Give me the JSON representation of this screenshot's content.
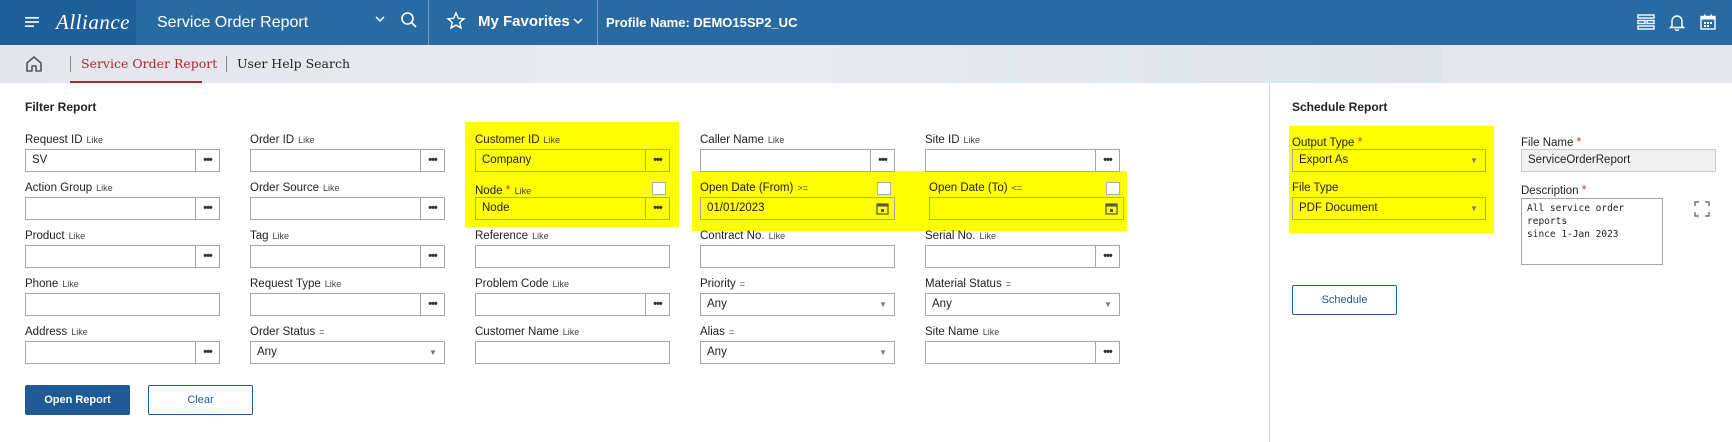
{
  "topbar": {
    "brand": "Alliance",
    "app_title": "Service Order Report",
    "favorites_label": "My Favorites",
    "profile_text": "Profile Name: DEMO15SP2_UC",
    "icons": [
      "menu-icon",
      "search-icon",
      "star-icon",
      "chevron-down-icon",
      "layout-icon",
      "bell-icon",
      "calendar-icon"
    ]
  },
  "nav": {
    "tabs": [
      {
        "label": "Service Order Report",
        "active": true
      },
      {
        "label": "User Help Search",
        "active": false
      }
    ]
  },
  "filter": {
    "title": "Filter Report",
    "fields": {
      "request_id": {
        "label": "Request ID",
        "op": "Like",
        "value": "SV"
      },
      "order_id": {
        "label": "Order ID",
        "op": "Like",
        "value": ""
      },
      "customer_id": {
        "label": "Customer ID",
        "op": "Like",
        "value": "Company"
      },
      "caller_name": {
        "label": "Caller Name",
        "op": "Like",
        "value": ""
      },
      "site_id": {
        "label": "Site ID",
        "op": "Like",
        "value": ""
      },
      "action_group": {
        "label": "Action Group",
        "op": "Like",
        "value": ""
      },
      "order_source": {
        "label": "Order Source",
        "op": "Like",
        "value": ""
      },
      "node": {
        "label": "Node",
        "op": "Like",
        "value": "Node",
        "required": "*"
      },
      "open_date_from": {
        "label": "Open Date (From)",
        "op": ">=",
        "value": "01/01/2023"
      },
      "open_date_to": {
        "label": "Open Date (To)",
        "op": "<=",
        "value": ""
      },
      "product": {
        "label": "Product",
        "op": "Like",
        "value": ""
      },
      "tag": {
        "label": "Tag",
        "op": "Like",
        "value": ""
      },
      "reference": {
        "label": "Reference",
        "op": "Like",
        "value": ""
      },
      "contract_no": {
        "label": "Contract No.",
        "op": "Like",
        "value": ""
      },
      "serial_no": {
        "label": "Serial No.",
        "op": "Like",
        "value": ""
      },
      "phone": {
        "label": "Phone",
        "op": "Like",
        "value": ""
      },
      "request_type": {
        "label": "Request Type",
        "op": "Like",
        "value": ""
      },
      "problem_code": {
        "label": "Problem Code",
        "op": "Like",
        "value": ""
      },
      "priority": {
        "label": "Priority",
        "op": "=",
        "value": "Any"
      },
      "material_status": {
        "label": "Material Status",
        "op": "=",
        "value": "Any"
      },
      "address": {
        "label": "Address",
        "op": "Like",
        "value": ""
      },
      "order_status": {
        "label": "Order Status",
        "op": "=",
        "value": "Any"
      },
      "customer_name": {
        "label": "Customer Name",
        "op": "Like",
        "value": ""
      },
      "alias": {
        "label": "Alias",
        "op": "=",
        "value": "Any"
      },
      "site_name": {
        "label": "Site Name",
        "op": "Like",
        "value": ""
      }
    },
    "open_report_label": "Open Report",
    "clear_label": "Clear"
  },
  "schedule": {
    "title": "Schedule Report",
    "output_type": {
      "label": "Output Type",
      "value": "Export As",
      "required": "*"
    },
    "file_name": {
      "label": "File Name",
      "value": "ServiceOrderReport",
      "required": "*"
    },
    "file_type": {
      "label": "File Type",
      "value": "PDF Document"
    },
    "description": {
      "label": "Description",
      "value": "All service order reports\nsince 1-Jan 2023",
      "required": "*"
    },
    "schedule_label": "Schedule"
  },
  "colors": {
    "topbar": "#2a6aa3",
    "primary": "#1f5a96",
    "active_tab": "#b0262e",
    "highlight": "#ffff00",
    "required": "#d93636"
  }
}
